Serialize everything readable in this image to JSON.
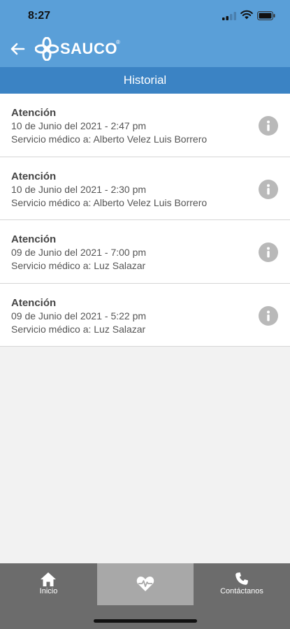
{
  "status_bar": {
    "time": "8:27"
  },
  "header": {
    "logo_text": "SAUCO",
    "logo_mark": "®"
  },
  "title_bar": {
    "title": "Historial"
  },
  "items": [
    {
      "title": "Atención",
      "date": "10 de Junio del 2021 - 2:47 pm",
      "service": "Servicio médico a: Alberto Velez Luis Borrero"
    },
    {
      "title": "Atención",
      "date": "10 de Junio del 2021 - 2:30 pm",
      "service": "Servicio médico a: Alberto Velez Luis Borrero"
    },
    {
      "title": "Atención",
      "date": "09 de Junio del 2021 - 7:00 pm",
      "service": "Servicio médico a: Luz Salazar"
    },
    {
      "title": "Atención",
      "date": "09 de Junio del 2021 - 5:22 pm",
      "service": "Servicio médico a: Luz Salazar"
    }
  ],
  "tab_bar": {
    "tabs": [
      {
        "label": "Inicio",
        "icon": "home-icon"
      },
      {
        "label": "",
        "icon": "heart-pulse-icon",
        "active": true
      },
      {
        "label": "Contáctanos",
        "icon": "phone-icon"
      }
    ]
  },
  "colors": {
    "header_bg": "#5a9fd8",
    "title_bar_bg": "#3b83c4",
    "tab_bar_bg": "#6c6c6c",
    "tab_active_bg": "#a8a8a8",
    "info_icon": "#b9b9b9"
  }
}
